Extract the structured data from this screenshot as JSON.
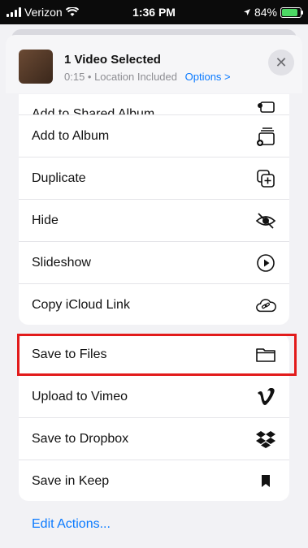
{
  "status": {
    "carrier": "Verizon",
    "time": "1:36 PM",
    "battery": "84%"
  },
  "header": {
    "title": "1 Video Selected",
    "meta": "0:15 • Location Included",
    "options_label": "Options >"
  },
  "actions_top": [
    {
      "label": "Add to Shared Album",
      "icon": "shared-album-icon"
    },
    {
      "label": "Add to Album",
      "icon": "album-icon"
    },
    {
      "label": "Duplicate",
      "icon": "duplicate-icon"
    },
    {
      "label": "Hide",
      "icon": "hide-icon"
    },
    {
      "label": "Slideshow",
      "icon": "play-icon"
    },
    {
      "label": "Copy iCloud Link",
      "icon": "cloud-link-icon"
    }
  ],
  "actions_bottom": [
    {
      "label": "Save to Files",
      "icon": "folder-icon"
    },
    {
      "label": "Upload to Vimeo",
      "icon": "vimeo-icon"
    },
    {
      "label": "Save to Dropbox",
      "icon": "dropbox-icon"
    },
    {
      "label": "Save in Keep",
      "icon": "bookmark-icon"
    }
  ],
  "footer": {
    "edit_actions": "Edit Actions..."
  },
  "colors": {
    "accent": "#0a7aff",
    "highlight": "#e21b1b"
  }
}
